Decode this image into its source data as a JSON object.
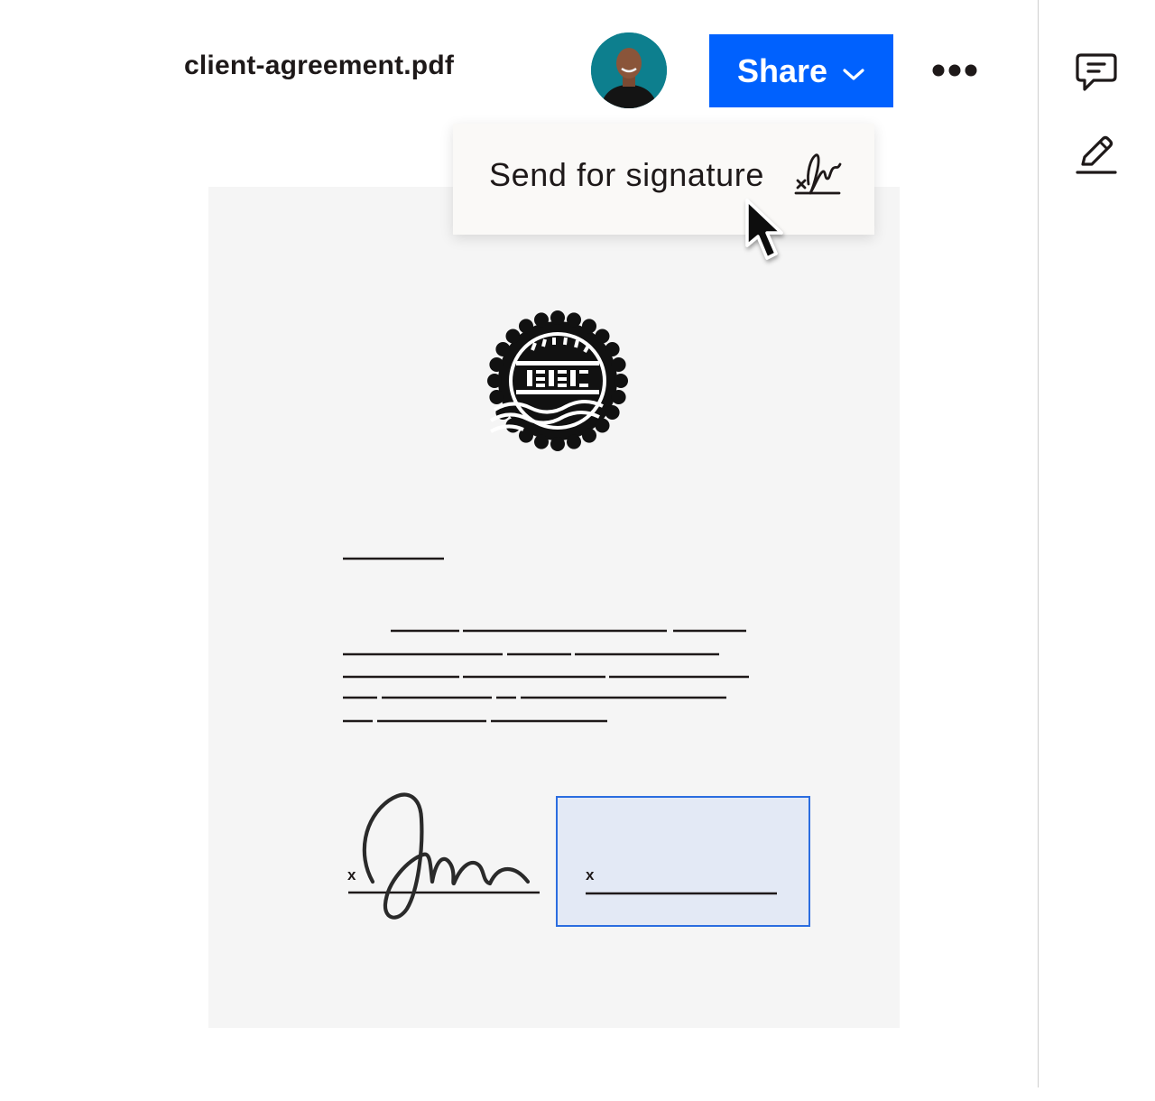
{
  "header": {
    "file_name": "client-agreement.pdf",
    "share_label": "Share",
    "share_icon": "chevron-down-icon",
    "more_icon": "ellipsis-icon"
  },
  "menu": {
    "items": [
      {
        "label": "Send for signature",
        "icon": "signature-icon"
      }
    ]
  },
  "right_rail": {
    "icons": [
      "comment-icon",
      "pencil-icon"
    ]
  },
  "document": {
    "signed_prefix": "x",
    "unsigned_prefix": "x"
  },
  "colors": {
    "accent": "#0061fe",
    "sign_field_fill": "#e3e9f5",
    "sign_field_border": "#2b6de0",
    "page_background": "#f5f5f5"
  }
}
